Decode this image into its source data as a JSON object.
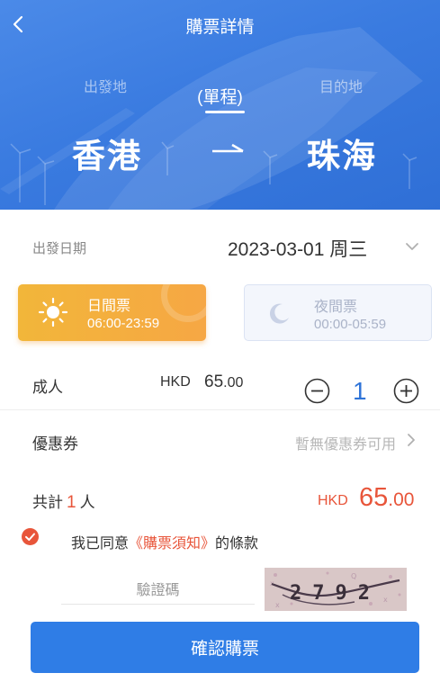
{
  "header": {
    "title": "購票詳情",
    "back_icon": "chevron-left-icon"
  },
  "route": {
    "from_label": "出發地",
    "to_label": "目的地",
    "trip_type": "(單程)",
    "from_city": "香港",
    "to_city": "珠海",
    "arrow_icon": "arrow-right-icon"
  },
  "date": {
    "label": "出發日期",
    "value": "2023-03-01 周三",
    "chevron_icon": "chevron-down-icon"
  },
  "tickets": [
    {
      "name": "日間票",
      "time": "06:00-23:59",
      "icon": "sun-icon",
      "selected": true
    },
    {
      "name": "夜間票",
      "time": "00:00-05:59",
      "icon": "moon-icon",
      "selected": false
    }
  ],
  "adult": {
    "label": "成人",
    "currency": "HKD",
    "price_int": "65",
    "price_dec": ".00",
    "quantity": "1"
  },
  "coupon": {
    "label": "優惠券",
    "value": "暫無優惠券可用"
  },
  "total": {
    "prefix": "共計",
    "count": "1",
    "suffix": "人",
    "currency": "HKD",
    "amount_int": "65",
    "amount_dec": ".00"
  },
  "agreement": {
    "checked": true,
    "text_before": "我已同意",
    "link_text": "《購票須知》",
    "text_after": "的條款"
  },
  "captcha": {
    "placeholder": "驗證碼",
    "image_text": "2792"
  },
  "confirm": {
    "label": "確認購票"
  },
  "colors": {
    "brand_blue": "#2f7de6",
    "accent_red": "#e8553a",
    "day_ticket": "#f2b63a"
  }
}
